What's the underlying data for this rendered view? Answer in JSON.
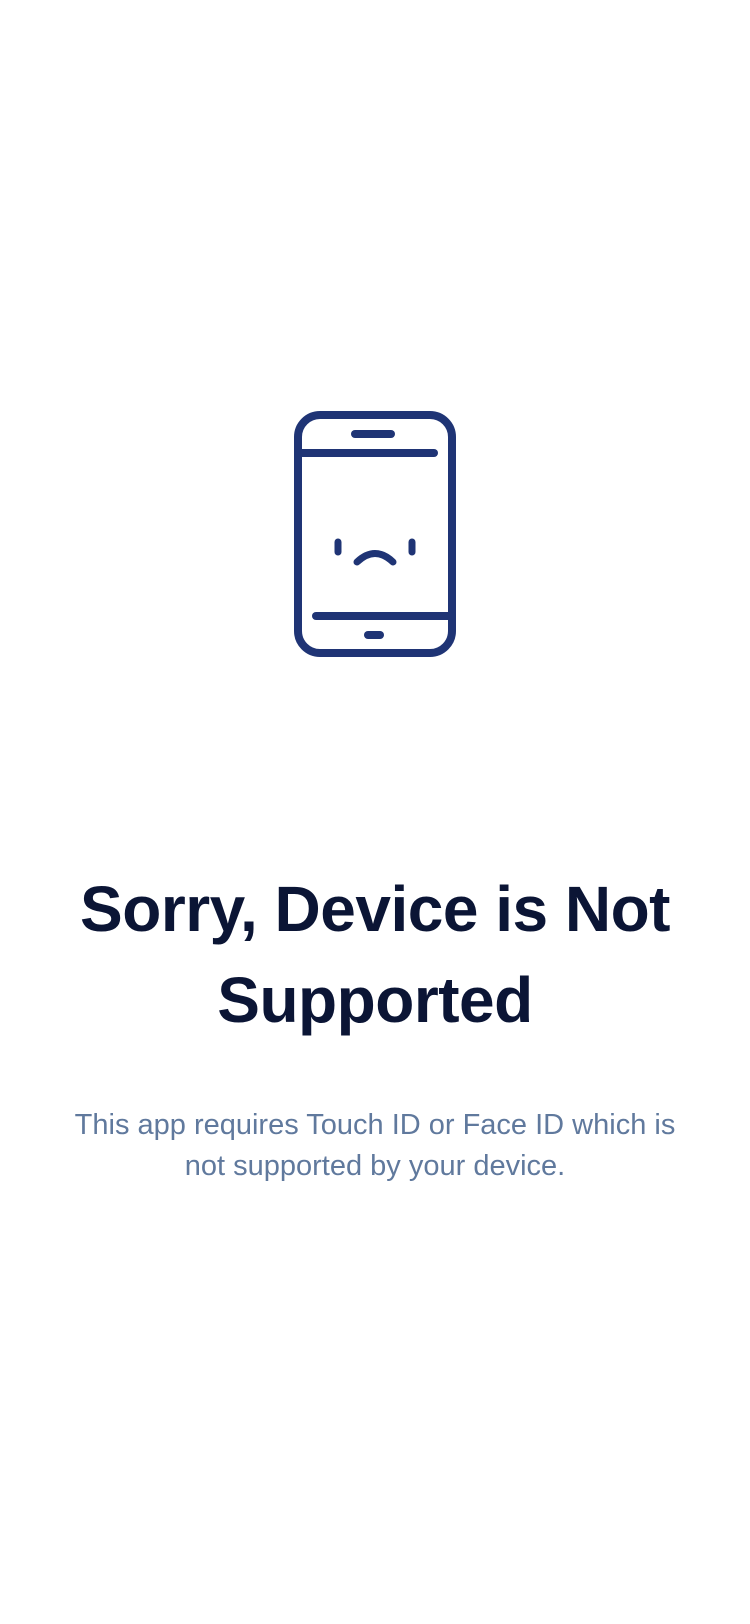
{
  "screen": {
    "icon": "sad-phone-icon",
    "title": "Sorry, Device is Not Supported",
    "message": "This app requires Touch ID or Face ID which is not supported by your device."
  },
  "colors": {
    "background": "#ffffff",
    "icon": "#1f3475",
    "title": "#0b1535",
    "message": "#60799d"
  }
}
